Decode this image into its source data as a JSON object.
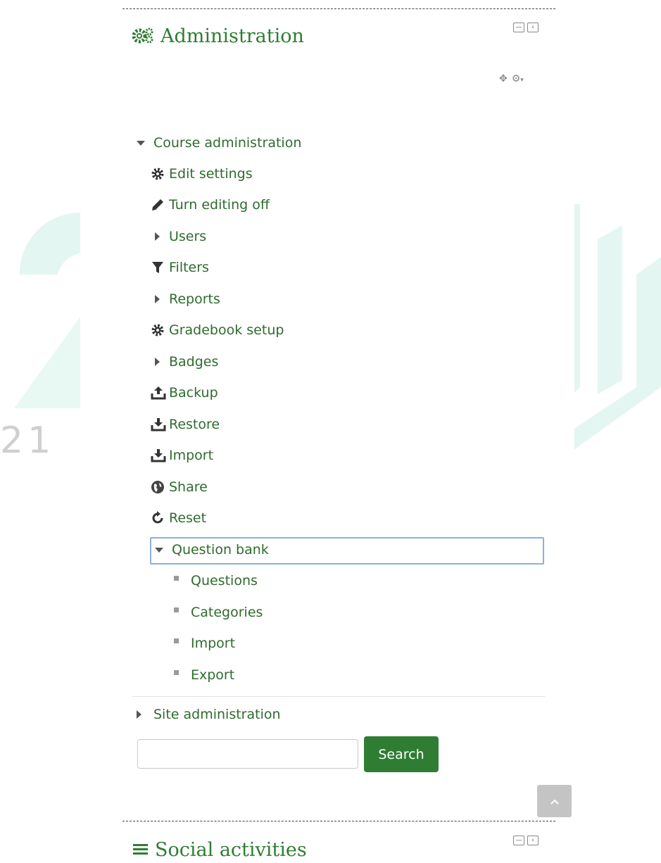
{
  "watermark_text": "21",
  "admin_block": {
    "title": "Administration",
    "icon": "cogs-icon"
  },
  "course_admin": {
    "label": "Course administration",
    "items": [
      {
        "label": "Edit settings",
        "icon": "gear-icon"
      },
      {
        "label": "Turn editing off",
        "icon": "pencil-icon"
      },
      {
        "label": "Users",
        "icon": "caret-right-icon"
      },
      {
        "label": "Filters",
        "icon": "filter-icon"
      },
      {
        "label": "Reports",
        "icon": "caret-right-icon"
      },
      {
        "label": "Gradebook setup",
        "icon": "gear-icon"
      },
      {
        "label": "Badges",
        "icon": "caret-right-icon"
      },
      {
        "label": "Backup",
        "icon": "upload-icon"
      },
      {
        "label": "Restore",
        "icon": "download-icon"
      },
      {
        "label": "Import",
        "icon": "download-icon"
      },
      {
        "label": "Share",
        "icon": "globe-icon"
      },
      {
        "label": "Reset",
        "icon": "reset-icon"
      }
    ]
  },
  "question_bank": {
    "label": "Question bank",
    "items": [
      "Questions",
      "Categories",
      "Import",
      "Export"
    ]
  },
  "site_admin": {
    "label": "Site administration"
  },
  "search": {
    "button_label": "Search",
    "value": ""
  },
  "social_block": {
    "title": "Social activities",
    "icon": "list-icon"
  },
  "colors": {
    "accent": "#2e7d32",
    "button": "#2f7d33",
    "focus": "#8ab0e0"
  }
}
